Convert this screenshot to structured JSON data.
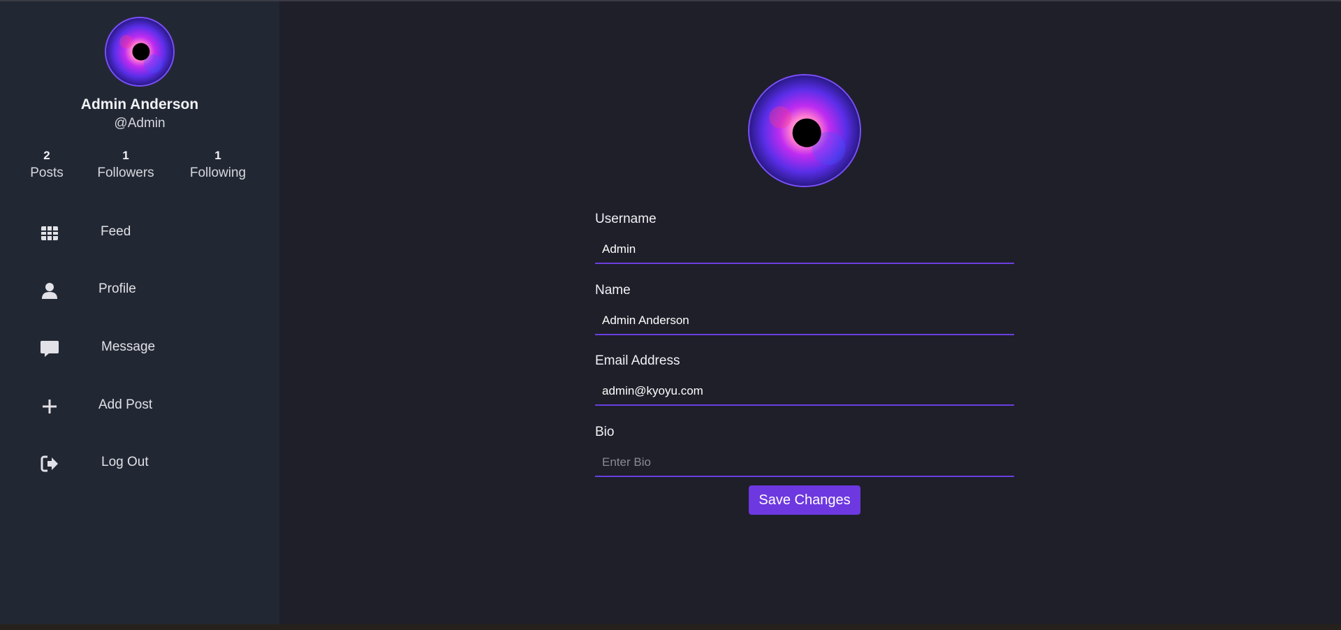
{
  "sidebar": {
    "name": "Admin Anderson",
    "handle": "@Admin",
    "stats": {
      "posts": {
        "count": "2",
        "label": "Posts"
      },
      "followers": {
        "count": "1",
        "label": "Followers"
      },
      "following": {
        "count": "1",
        "label": "Following"
      }
    },
    "nav": {
      "feed": {
        "label": "Feed",
        "icon": "grid-icon"
      },
      "profile": {
        "label": "Profile",
        "icon": "user-icon"
      },
      "message": {
        "label": "Message",
        "icon": "chat-icon"
      },
      "add_post": {
        "label": "Add Post",
        "icon": "plus-icon"
      },
      "logout": {
        "label": "Log Out",
        "icon": "logout-icon"
      }
    }
  },
  "form": {
    "username": {
      "label": "Username",
      "value": "Admin"
    },
    "name": {
      "label": "Name",
      "value": "Admin Anderson"
    },
    "email": {
      "label": "Email Address",
      "value": "admin@kyoyu.com"
    },
    "bio": {
      "label": "Bio",
      "value": "",
      "placeholder": "Enter Bio"
    },
    "save_label": "Save Changes"
  },
  "colors": {
    "accent": "#6d38e0",
    "sidebar_bg": "#222833",
    "main_bg": "#1e1f29"
  }
}
